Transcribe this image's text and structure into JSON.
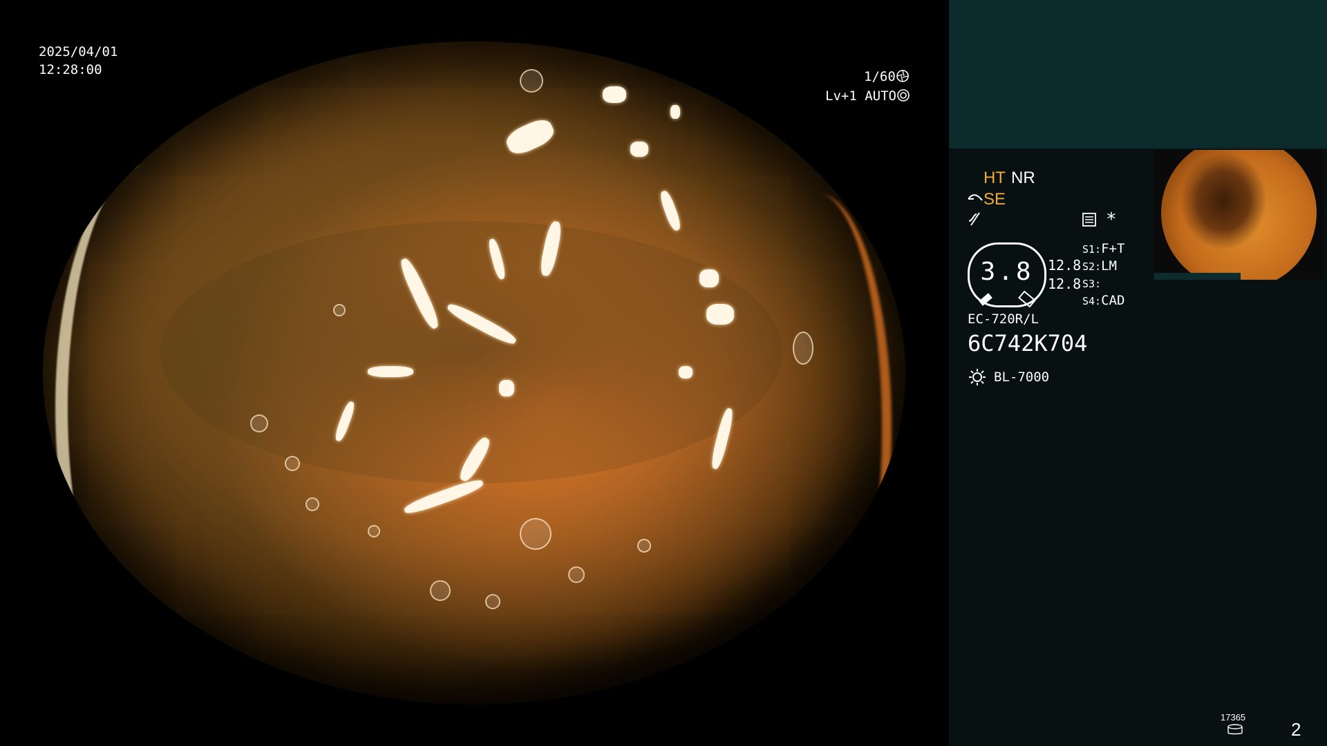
{
  "osd": {
    "date": "2025/04/01",
    "time": "12:28:00",
    "shutter": "1/60",
    "shutter_icon": "aperture-icon",
    "level": "Lv+1",
    "iris_mode": "AUTO",
    "iris_icon": "iris-icon"
  },
  "sidebar": {
    "modes": {
      "ht": "HT",
      "nr": "NR",
      "se": "SE",
      "se_icon": "bend-icon",
      "extra_icon": "frequency-icon",
      "record_icon": "record-settings-icon",
      "star": "*"
    },
    "zoom": {
      "value": "3.8",
      "upper_value": "12.8",
      "lower_value": "12.8"
    },
    "switches": [
      {
        "key": "S1:",
        "value": "F+T"
      },
      {
        "key": "S2:",
        "value": "LM"
      },
      {
        "key": "S3:",
        "value": ""
      },
      {
        "key": "S4:",
        "value": "CAD"
      }
    ],
    "scope_model": "EC-720R/L",
    "serial": "6C742K704",
    "light_source": "BL-7000",
    "light_icon": "lamp-icon",
    "storage_count": "17365",
    "storage_icon": "database-icon",
    "page_number": "2"
  },
  "colors": {
    "accent_orange": "#f5a938",
    "sidebar_background": "#071112",
    "sidebar_header": "#0c2b2c"
  }
}
